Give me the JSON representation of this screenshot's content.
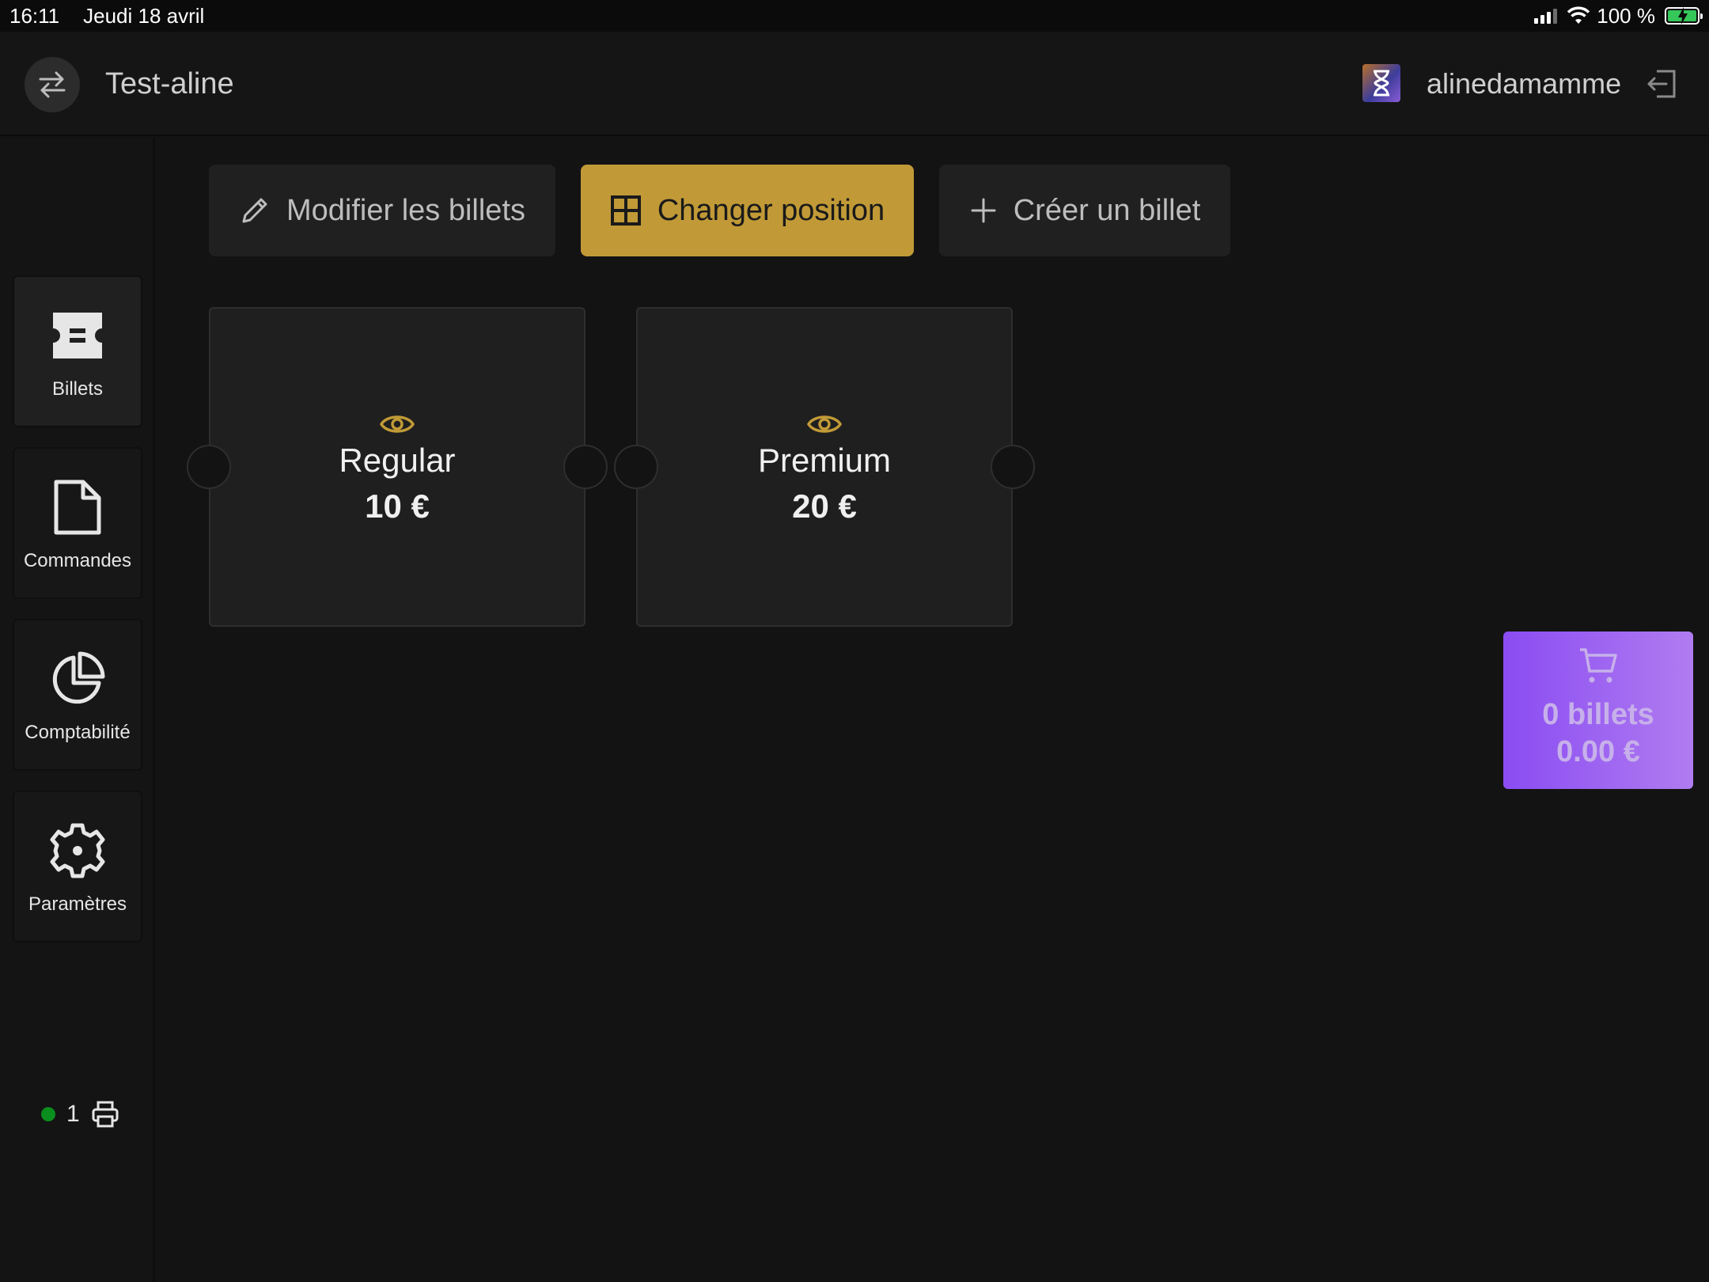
{
  "status_bar": {
    "time": "16:11",
    "date": "Jeudi 18 avril",
    "battery_percent": "100 %"
  },
  "header": {
    "title": "Test-aline",
    "username": "alinedamamme"
  },
  "toolbar": {
    "edit_label": "Modifier les billets",
    "position_label": "Changer position",
    "create_label": "Créer un billet"
  },
  "sidebar": {
    "items": [
      {
        "label": "Billets",
        "icon": "ticket-icon"
      },
      {
        "label": "Commandes",
        "icon": "document-icon"
      },
      {
        "label": "Comptabilité",
        "icon": "pie-chart-icon"
      },
      {
        "label": "Paramètres",
        "icon": "gear-icon"
      }
    ],
    "printer_count": "1"
  },
  "tickets": [
    {
      "name": "Regular",
      "price": "10 €"
    },
    {
      "name": "Premium",
      "price": "20 €"
    }
  ],
  "cart": {
    "count": "0 billets",
    "total": "0.00 €"
  },
  "colors": {
    "accent": "#c19a37",
    "cart": "#8a4cf2",
    "printer_ok": "#0a8f1e"
  }
}
